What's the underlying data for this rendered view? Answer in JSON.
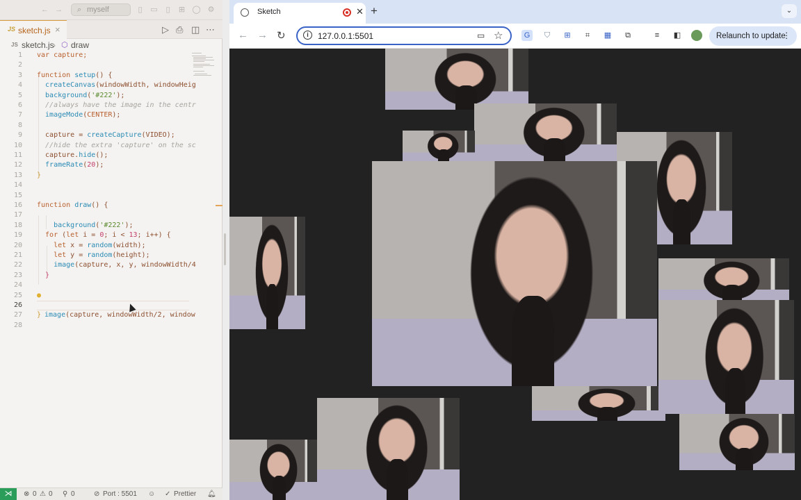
{
  "editor": {
    "command_center_label": "myself",
    "tab_label": "sketch.js",
    "tab_file_type": "JS",
    "breadcrumb_file": "sketch.js",
    "breadcrumb_symbol": "draw",
    "lines": [
      {
        "n": "1"
      },
      {
        "n": "2"
      },
      {
        "n": "3"
      },
      {
        "n": "4"
      },
      {
        "n": "5"
      },
      {
        "n": "6"
      },
      {
        "n": "7"
      },
      {
        "n": "8"
      },
      {
        "n": "9"
      },
      {
        "n": "10"
      },
      {
        "n": "11"
      },
      {
        "n": "12"
      },
      {
        "n": "13"
      },
      {
        "n": "14"
      },
      {
        "n": "15"
      },
      {
        "n": "16"
      },
      {
        "n": "17"
      },
      {
        "n": "18"
      },
      {
        "n": "19"
      },
      {
        "n": "20"
      },
      {
        "n": "21"
      },
      {
        "n": "22"
      },
      {
        "n": "23"
      },
      {
        "n": "24"
      },
      {
        "n": "25"
      },
      {
        "n": "26"
      },
      {
        "n": "27"
      },
      {
        "n": "28"
      }
    ],
    "code": {
      "l1": "var capture;",
      "l3a": "function",
      "l3b": " setup",
      "l3c": "() {",
      "l4a": "  createCanvas",
      "l4b": "(windowWidth, windowHeig",
      "l5a": "  background",
      "l5b": "(",
      "l5c": "'#222'",
      "l5d": ");",
      "l6": "  //always have the image in the centr",
      "l7a": "  imageMode",
      "l7b": "(",
      "l7c": "CENTER",
      "l7d": ");",
      "l9a": "  capture = ",
      "l9b": "createCapture",
      "l9c": "(VIDEO);",
      "l10": "  //hide the extra 'capture' on the sc",
      "l11a": "  capture.",
      "l11b": "hide",
      "l11c": "();",
      "l12a": "  frameRate",
      "l12b": "(",
      "l12c": "20",
      "l12d": ");",
      "l13": "}",
      "l16a": "function",
      "l16b": " draw",
      "l16c": "() {",
      "l18a": "    background",
      "l18b": "(",
      "l18c": "'#222'",
      "l18d": ");",
      "l19a": "  for",
      "l19b": " (",
      "l19c": "let",
      "l19d": " i = ",
      "l19e": "0",
      "l19f": "; i < ",
      "l19g": "13",
      "l19h": "; i++) {",
      "l20a": "    let",
      "l20b": " x = ",
      "l20c": "random",
      "l20d": "(width);",
      "l21a": "    let",
      "l21b": " y = ",
      "l21c": "random",
      "l21d": "(height);",
      "l22a": "    image",
      "l22b": "(capture, x, y, windowWidth/4",
      "l23": "  }",
      "l25a": "image",
      "l25b": "(capture, windowWidth/2, window",
      "l27": "}"
    }
  },
  "status_bar": {
    "errors": "0",
    "warnings": "0",
    "ports_count": "0",
    "port_label": "Port : 5501",
    "prettier_label": "Prettier"
  },
  "browser": {
    "tab_title": "Sketch",
    "url": "127.0.0.1:5501",
    "relaunch_label": "Relaunch to update"
  },
  "colors": {
    "canvas_bg": "#222222",
    "omnibox_border": "#3a63c7",
    "remote_indicator": "#2a9d5b"
  }
}
